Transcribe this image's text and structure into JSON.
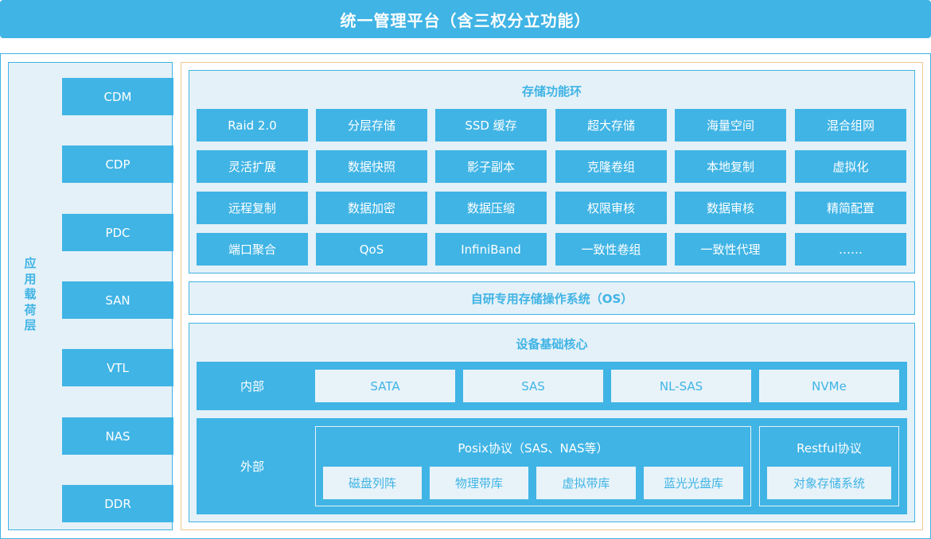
{
  "header": {
    "title": "统一管理平台（含三权分立功能）"
  },
  "left_panel": {
    "label": "应用载荷层",
    "items": [
      "CDM",
      "CDP",
      "PDC",
      "SAN",
      "VTL",
      "NAS",
      "DDR"
    ]
  },
  "storage_ring": {
    "title": "存储功能环",
    "rows": [
      [
        "Raid 2.0",
        "分层存储",
        "SSD 缓存",
        "超大存储",
        "海量空间",
        "混合组网"
      ],
      [
        "灵活扩展",
        "数据快照",
        "影子副本",
        "克隆卷组",
        "本地复制",
        "虚拟化"
      ],
      [
        "远程复制",
        "数据加密",
        "数据压缩",
        "权限审核",
        "数据审核",
        "精简配置"
      ],
      [
        "端口聚合",
        "QoS",
        "InfiniBand",
        "一致性卷组",
        "一致性代理",
        "……"
      ]
    ]
  },
  "os_bar": {
    "title": "自研专用存储操作系统（OS）"
  },
  "core": {
    "title": "设备基础核心",
    "internal": {
      "label": "内部",
      "items": [
        "SATA",
        "SAS",
        "NL-SAS",
        "NVMe"
      ]
    },
    "external": {
      "label": "外部",
      "posix": {
        "title": "Posix协议（SAS、NAS等）",
        "items": [
          "磁盘列阵",
          "物理带库",
          "虚拟带库",
          "蓝光光盘库"
        ]
      },
      "restful": {
        "title": "Restful协议",
        "items": [
          "对象存储系统"
        ]
      }
    }
  },
  "colors": {
    "primary": "#40b4e5",
    "panel_bg": "#e4f1f8",
    "light_cell": "#e8f3f9",
    "frame_accent": "#f0c890"
  }
}
